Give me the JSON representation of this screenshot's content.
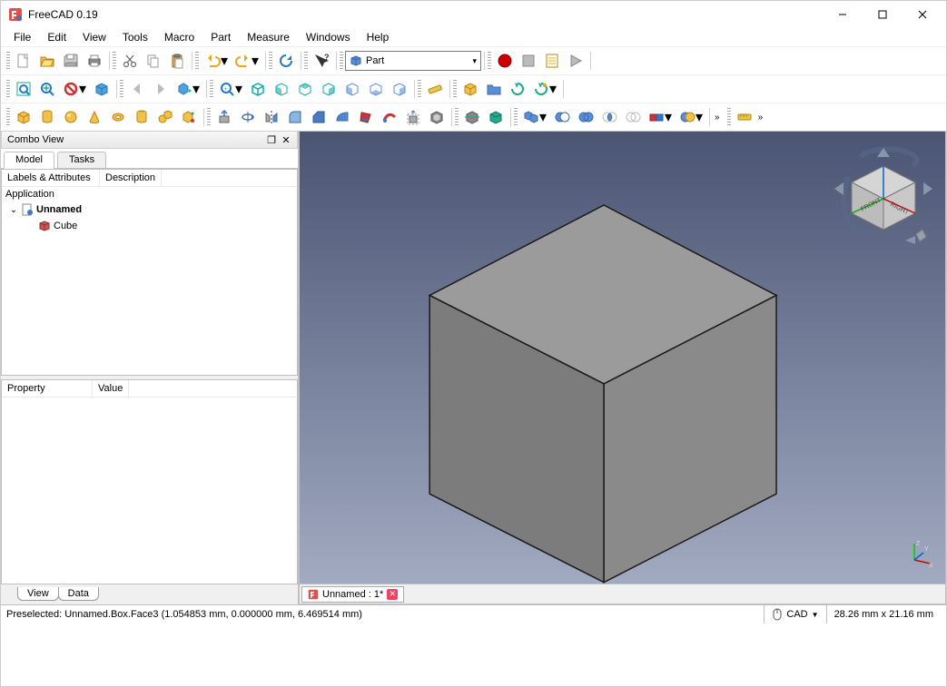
{
  "title": "FreeCAD 0.19",
  "menu": [
    "File",
    "Edit",
    "View",
    "Tools",
    "Macro",
    "Part",
    "Measure",
    "Windows",
    "Help"
  ],
  "workbench_selector": "Part",
  "combo_view": {
    "title": "Combo View",
    "tabs": [
      "Model",
      "Tasks"
    ],
    "tree": {
      "columns": [
        "Labels & Attributes",
        "Description"
      ],
      "root": "Application",
      "doc": "Unnamed",
      "item": "Cube"
    },
    "props": {
      "columns": [
        "Property",
        "Value"
      ]
    },
    "bottom_tabs": [
      "View",
      "Data"
    ]
  },
  "doc_tab": "Unnamed : 1*",
  "status": {
    "message": "Preselected: Unnamed.Box.Face3 (1.054853 mm, 0.000000 mm, 6.469514 mm)",
    "nav_style": "CAD",
    "dims": "28.26 mm x 21.16 mm"
  },
  "axis_labels": {
    "x": "X",
    "y": "Y",
    "z": "Z"
  }
}
